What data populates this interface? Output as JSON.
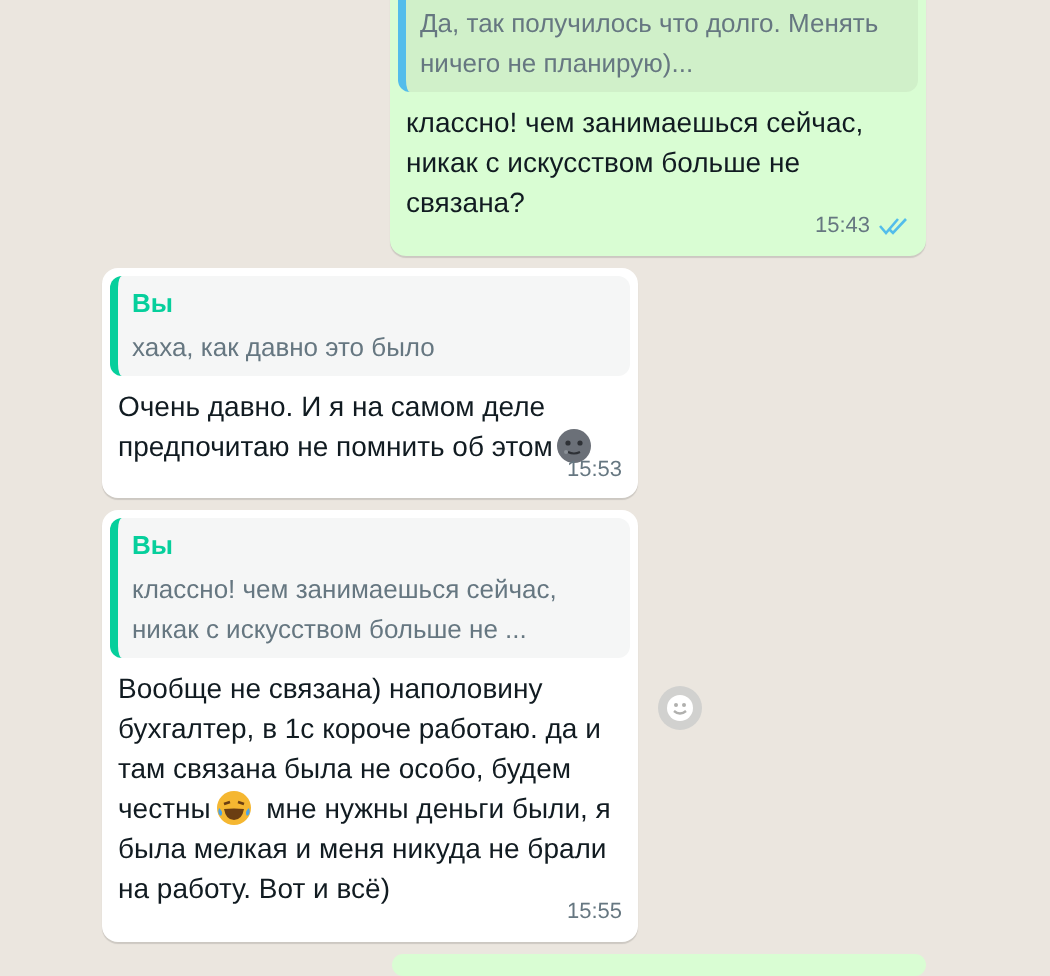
{
  "messages": [
    {
      "kind": "outgoing",
      "quote": {
        "text": "Да, так получилось что долго. Менять ничего не планирую)..."
      },
      "text": "классно! чем занимаешься сейчас, никак с искусством больше не связана?",
      "time": "15:43",
      "read": true
    },
    {
      "kind": "incoming",
      "quote": {
        "author": "Вы",
        "text": "хаха, как давно это было"
      },
      "text": "Очень давно. И я на самом деле предпочитаю не помнить об этом",
      "emoji": {
        "kind": "moon"
      },
      "time": "15:53"
    },
    {
      "kind": "incoming",
      "quote": {
        "author": "Вы",
        "text": "классно! чем занимаешься сейчас, никак с искусством больше не ..."
      },
      "text": "Вообще не связана) наполовину бухгалтер, в 1с короче работаю. да и там связана была не особо, будем честны",
      "emoji": {
        "kind": "laugh"
      },
      "text_after": "мне нужны деньги были, я была мелкая и меня никуда не брали на работу. Вот и всё)",
      "time": "15:55",
      "reaction_button": true
    },
    {
      "kind": "outgoing"
    }
  ]
}
